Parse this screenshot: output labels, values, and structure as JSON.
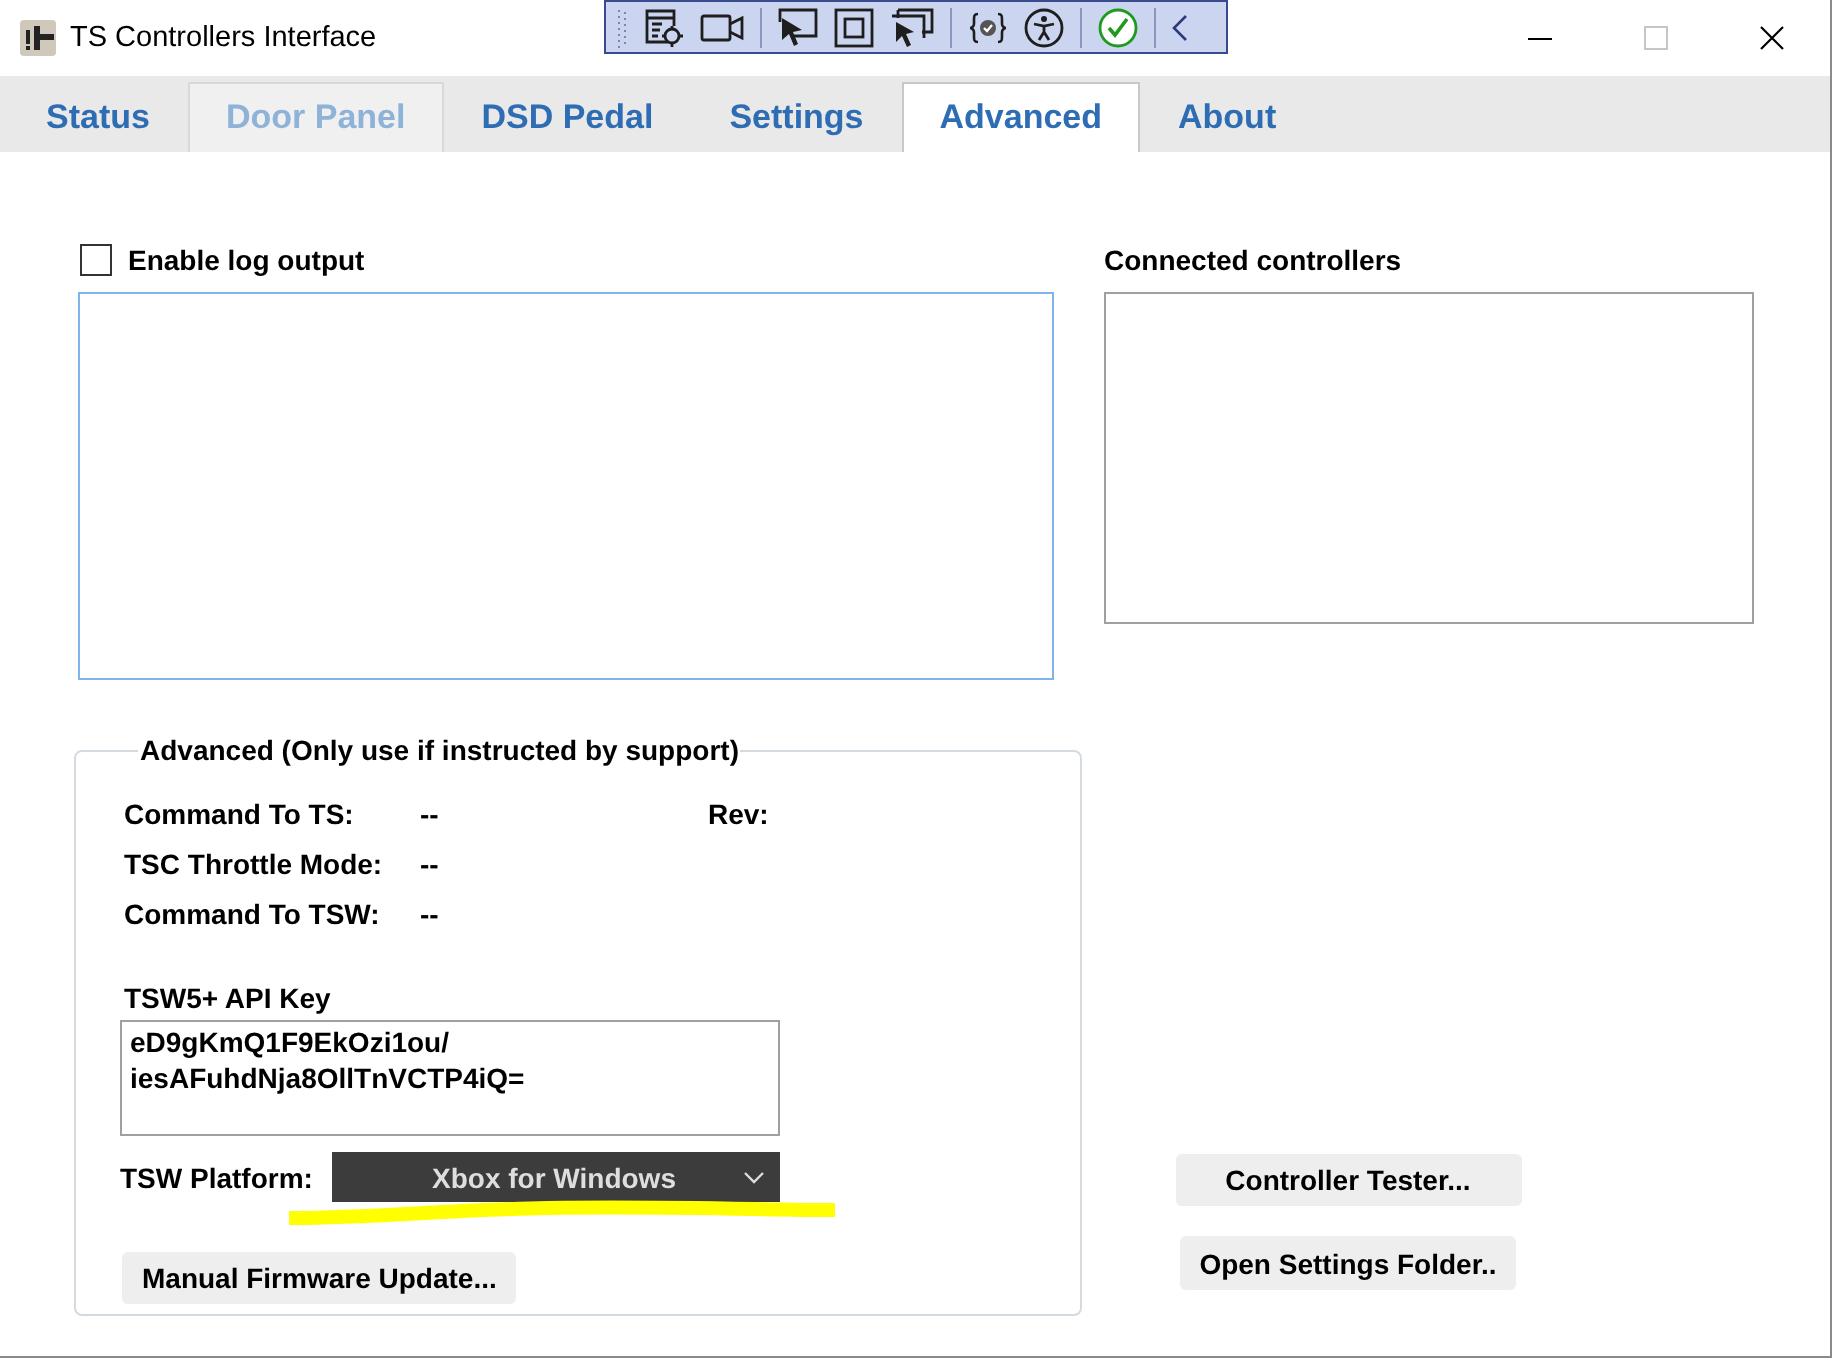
{
  "window": {
    "title": "TS Controllers Interface",
    "controls": [
      {
        "kind": "minimize",
        "disabled": false
      },
      {
        "kind": "maximize",
        "disabled": true
      },
      {
        "kind": "close",
        "disabled": false
      }
    ]
  },
  "tabs": [
    {
      "label": "Status",
      "selected": false,
      "disabled": false
    },
    {
      "label": "Door Panel",
      "selected": false,
      "disabled": true
    },
    {
      "label": "DSD Pedal",
      "selected": false,
      "disabled": false
    },
    {
      "label": "Settings",
      "selected": false,
      "disabled": false
    },
    {
      "label": "Advanced",
      "selected": true,
      "disabled": false
    },
    {
      "label": "About",
      "selected": false,
      "disabled": false
    }
  ],
  "log": {
    "enable_label": "Enable log output",
    "checked": false
  },
  "connected_controllers": {
    "label": "Connected controllers"
  },
  "advanced_group": {
    "title": "Advanced (Only use if instructed by support)",
    "fields": [
      {
        "label": "Command To TS:",
        "value": "--",
        "extra_label": "Rev:"
      },
      {
        "label": "TSC Throttle Mode:",
        "value": "--"
      },
      {
        "label": "Command To TSW:",
        "value": "--"
      }
    ],
    "api_key": {
      "label": "TSW5+ API Key",
      "lines": [
        "eD9gKmQ1F9EkOzi1ou/",
        "iesAFuhdNja8OllTnVCTP4iQ="
      ]
    },
    "platform": {
      "label": "TSW Platform:",
      "value": "Xbox for Windows"
    },
    "buttons": [
      "Manual Firmware Update..."
    ]
  },
  "buttons": [
    "Controller Tester...",
    "Open Settings Folder.."
  ]
}
